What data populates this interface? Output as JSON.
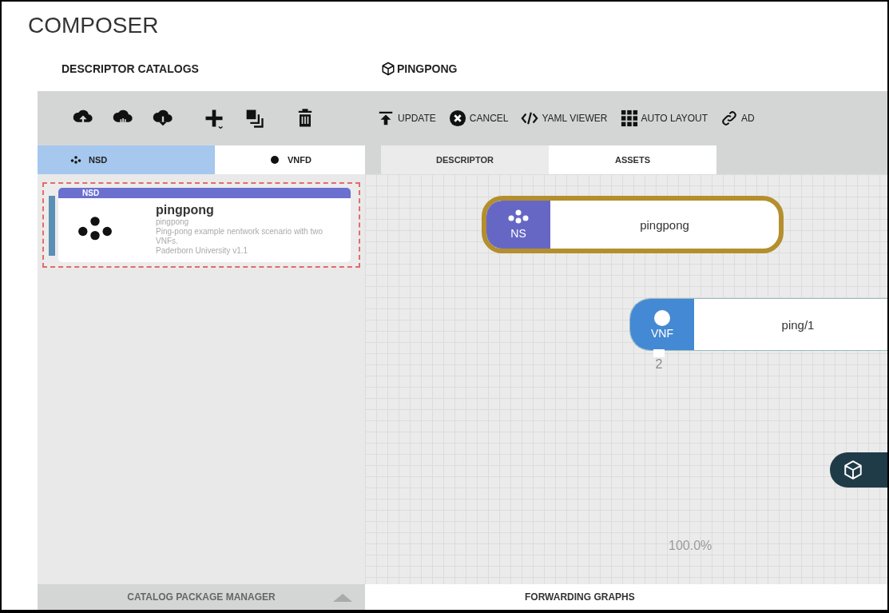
{
  "app_title": "COMPOSER",
  "catalog": {
    "title": "DESCRIPTOR CATALOGS",
    "tabs": [
      {
        "label": "NSD",
        "kind": "ns",
        "selected": true
      },
      {
        "label": "VNFD",
        "kind": "vnf",
        "selected": false
      }
    ],
    "items": [
      {
        "badge": "NSD",
        "name": "pingpong",
        "short_name": "pingpong",
        "description": "Ping-pong example nentwork scenario with two VNFs.",
        "vendor_version": "Paderborn University v1.1",
        "selected": true
      }
    ],
    "footer": "CATALOG PACKAGE MANAGER"
  },
  "editor": {
    "title": "PINGPONG",
    "actions": [
      {
        "label": "UPDATE",
        "kind": "update"
      },
      {
        "label": "CANCEL",
        "kind": "cancel"
      },
      {
        "label": "YAML VIEWER",
        "kind": "code"
      },
      {
        "label": "AUTO LAYOUT",
        "kind": "grid"
      },
      {
        "label": "AD",
        "kind": "link"
      }
    ],
    "tabs": [
      {
        "label": "DESCRIPTOR",
        "selected": true
      },
      {
        "label": "ASSETS",
        "selected": false
      }
    ],
    "nodes": [
      {
        "kind": "ns",
        "type_label": "NS",
        "name": "pingpong",
        "selected": true
      },
      {
        "kind": "vnf",
        "type_label": "VNF",
        "name": "ping/1",
        "selected": false,
        "port": "2"
      }
    ],
    "zoom": "100.0%",
    "footer": "FORWARDING GRAPHS"
  }
}
